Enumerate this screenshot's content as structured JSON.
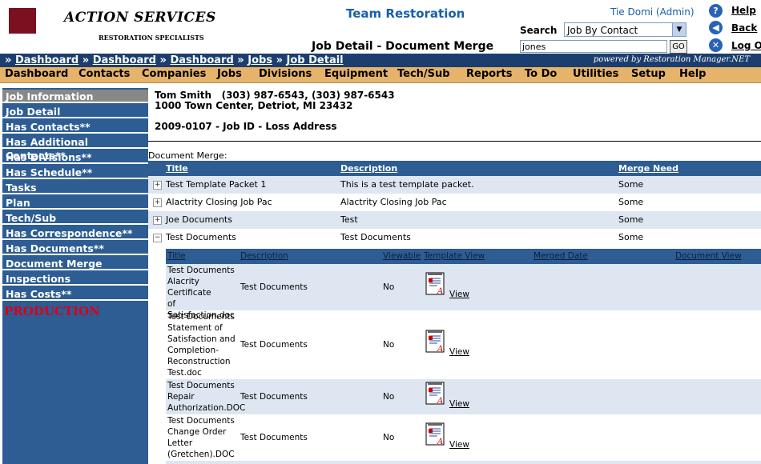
{
  "brand": {
    "name": "ACTION SERVICES",
    "tagline": "RESTORATION SPECIALISTS"
  },
  "header": {
    "company": "Team Restoration",
    "page_title": "Job Detail - Document Merge",
    "user": "Tie Domi (Admin)",
    "search_label": "Search",
    "search_type": "Job By Contact",
    "search_value": "jones",
    "go_label": "GO",
    "links": [
      {
        "label": "Help",
        "icon": "help-icon",
        "color": "#2a62b5"
      },
      {
        "label": "Back",
        "icon": "back-icon",
        "color": "#2a62b5"
      },
      {
        "label": "Log Out",
        "icon": "logout-icon",
        "color": "#2a62b5"
      }
    ]
  },
  "breadcrumbs": [
    "Dashboard",
    "Dashboard",
    "Dashboard",
    "Jobs",
    "Job Detail"
  ],
  "powered_by": "powered by Restoration Manager.NET",
  "menu": [
    "Dashboard",
    "Contacts",
    "Companies",
    "Jobs",
    "Divisions",
    "Equipment",
    "Tech/Sub",
    "Reports",
    "To Do",
    "Utilities",
    "Setup",
    "Help"
  ],
  "sidebar": {
    "items": [
      "Job Information",
      "Job Detail",
      "Has Contacts**",
      "Has Additional Contacts**",
      "Has Divisions**",
      "Has Schedule**",
      "Tasks",
      "Plan",
      "Tech/Sub",
      "Has Correspondence**",
      "Has Documents**",
      "Document Merge",
      "Inspections",
      "Has Costs**"
    ],
    "active": "Job Information",
    "production_label": "PRODUCTION"
  },
  "contact": {
    "name_phone": "Tom Smith   (303) 987-6543, (303) 987-6543",
    "address": "1000 Town Center, Detriot, MI 23432",
    "job_line": "2009-0107 - Job ID - Loss Address"
  },
  "document_merge": {
    "label": "Document Merge:",
    "columns": [
      "Title",
      "Description",
      "Merge Need"
    ],
    "rows": [
      {
        "title": "Test Template Packet 1",
        "description": "This is a test template packet.",
        "merge_need": "Some",
        "expanded": false
      },
      {
        "title": "Alactrity Closing Job Pac",
        "description": "Alactrity Closing Job Pac",
        "merge_need": "Some",
        "expanded": false
      },
      {
        "title": "Joe Documents",
        "description": "Test",
        "merge_need": "Some",
        "expanded": false
      },
      {
        "title": "Test Documents",
        "description": "Test Documents",
        "merge_need": "Some",
        "expanded": true
      }
    ],
    "sub_columns": [
      "Title",
      "Description",
      "Viewable",
      "Template View",
      "Merged Date",
      "Document View"
    ],
    "sub_rows": [
      {
        "title_lines": [
          "Test Documents",
          "Alacrity Certificate",
          "of",
          "Satisfaction.doc"
        ],
        "description": "Test Documents",
        "viewable": "No",
        "view_label": "View"
      },
      {
        "title_lines": [
          "Test Documents",
          "Statement of",
          "Satisfaction and",
          "Completion-",
          "Reconstruction",
          "Test.doc"
        ],
        "description": "Test Documents",
        "viewable": "No",
        "view_label": "View"
      },
      {
        "title_lines": [
          "Test Documents",
          "Repair",
          "Authorization.DOC"
        ],
        "description": "Test Documents",
        "viewable": "No",
        "view_label": "View"
      },
      {
        "title_lines": [
          "Test Documents",
          "Change Order",
          "Letter",
          "(Gretchen).DOC"
        ],
        "description": "Test Documents",
        "viewable": "No",
        "view_label": "View"
      }
    ]
  }
}
